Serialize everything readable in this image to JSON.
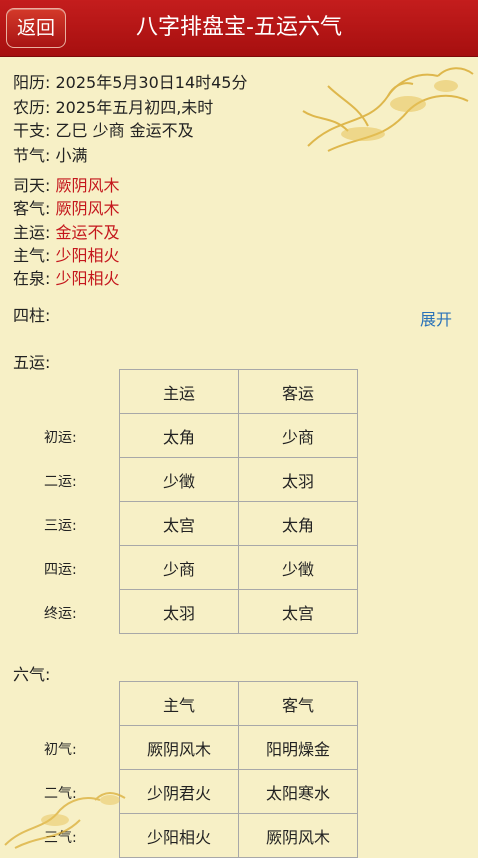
{
  "header": {
    "back_label": "返回",
    "title": "八字排盘宝-五运六气"
  },
  "info": [
    {
      "label": "阳历:",
      "value": "2025年5月30日14时45分",
      "red": false
    },
    {
      "label": "农历:",
      "value": "2025年五月初四,未时",
      "red": false
    },
    {
      "label": "干支:",
      "value": "乙巳  少商  金运不及",
      "red": false
    },
    {
      "label": "节气:",
      "value": "小满",
      "red": false
    },
    {
      "label": "司天:",
      "value": "厥阴风木",
      "red": true
    },
    {
      "label": "客气:",
      "value": "厥阴风木",
      "red": true
    },
    {
      "label": "主运:",
      "value": "金运不及",
      "red": true
    },
    {
      "label": "主气:",
      "value": "少阳相火",
      "red": true
    },
    {
      "label": "在泉:",
      "value": "少阳相火",
      "red": true
    }
  ],
  "pillars": {
    "label": "四柱:",
    "expand_label": "展开"
  },
  "wuyun": {
    "title": "五运:",
    "headers": [
      "主运",
      "客运"
    ],
    "rows": [
      {
        "label": "初运:",
        "main": "太角",
        "guest": "少商"
      },
      {
        "label": "二运:",
        "main": "少徵",
        "guest": "太羽"
      },
      {
        "label": "三运:",
        "main": "太宫",
        "guest": "太角"
      },
      {
        "label": "四运:",
        "main": "少商",
        "guest": "少徵"
      },
      {
        "label": "终运:",
        "main": "太羽",
        "guest": "太宫"
      }
    ]
  },
  "liuqi": {
    "title": "六气:",
    "headers": [
      "主气",
      "客气"
    ],
    "rows": [
      {
        "label": "初气:",
        "main": "厥阴风木",
        "guest": "阳明燥金"
      },
      {
        "label": "二气:",
        "main": "少阴君火",
        "guest": "太阳寒水"
      },
      {
        "label": "三气:",
        "main": "少阳相火",
        "guest": "厥阴风木"
      }
    ]
  },
  "colors": {
    "header_bg": "#b71515",
    "background": "#f7f0c6",
    "accent_red": "#c4161c",
    "link_blue": "#2a72b8"
  }
}
